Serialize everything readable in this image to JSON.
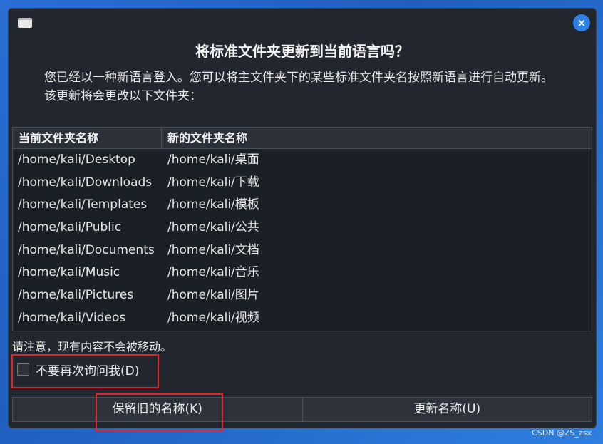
{
  "dialog": {
    "title": "将标准文件夹更新到当前语言吗？",
    "description": "您已经以一种新语言登入。您可以将主文件夹下的某些标准文件夹名按照新语言进行自动更新。该更新将会更改以下文件夹：",
    "close_icon": "×",
    "columns": [
      "当前文件夹名称",
      "新的文件夹名称"
    ],
    "rows": [
      [
        "/home/kali/Desktop",
        "/home/kali/桌面"
      ],
      [
        "/home/kali/Downloads",
        "/home/kali/下载"
      ],
      [
        "/home/kali/Templates",
        "/home/kali/模板"
      ],
      [
        "/home/kali/Public",
        "/home/kali/公共"
      ],
      [
        "/home/kali/Documents",
        "/home/kali/文档"
      ],
      [
        "/home/kali/Music",
        "/home/kali/音乐"
      ],
      [
        "/home/kali/Pictures",
        "/home/kali/图片"
      ],
      [
        "/home/kali/Videos",
        "/home/kali/视频"
      ]
    ],
    "note": "请注意，现有内容不会被移动。",
    "checkbox_label": "不要再次询问我(D)",
    "checkbox_checked": false,
    "keep_button": "保留旧的名称(K)",
    "update_button": "更新名称(U)"
  },
  "watermark": "CSDN @ZS_zsx",
  "colors": {
    "accent": "#2f7fe8",
    "highlight": "#e0242b",
    "dialog_bg": "#22272f"
  }
}
